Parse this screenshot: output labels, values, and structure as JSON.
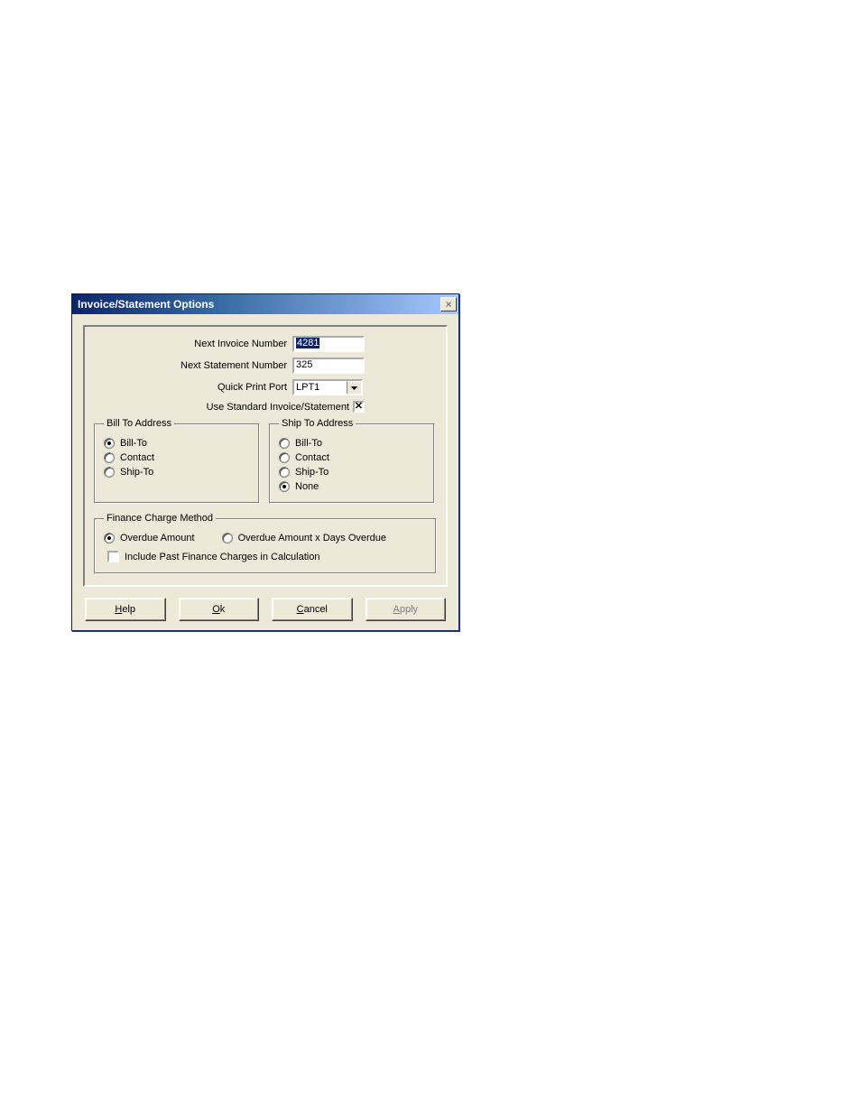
{
  "dialog": {
    "title": "Invoice/Statement Options",
    "close_glyph": "×",
    "fields": {
      "next_invoice_label": "Next Invoice Number",
      "next_invoice_value": "4281",
      "next_statement_label": "Next Statement Number",
      "next_statement_value": "325",
      "quick_print_label": "Quick Print Port",
      "quick_print_value": "LPT1",
      "use_standard_label": "Use Standard Invoice/Statement",
      "use_standard_checked_glyph": "✕"
    },
    "bill_to": {
      "legend": "Bill To Address",
      "options": [
        {
          "label": "Bill-To",
          "selected": true
        },
        {
          "label": "Contact",
          "selected": false
        },
        {
          "label": "Ship-To",
          "selected": false
        }
      ]
    },
    "ship_to": {
      "legend": "Ship To Address",
      "options": [
        {
          "label": "Bill-To",
          "selected": false
        },
        {
          "label": "Contact",
          "selected": false
        },
        {
          "label": "Ship-To",
          "selected": false
        },
        {
          "label": "None",
          "selected": true
        }
      ]
    },
    "fcm": {
      "legend": "Finance Charge Method",
      "overdue_amount_label": "Overdue Amount",
      "overdue_amount_selected": true,
      "overdue_days_label": "Overdue Amount x Days Overdue",
      "overdue_days_selected": false,
      "include_past_label": "Include Past Finance Charges in Calculation",
      "include_past_checked": false
    },
    "buttons": {
      "help_pre": "",
      "help_mn": "H",
      "help_post": "elp",
      "ok_pre": "",
      "ok_mn": "O",
      "ok_post": "k",
      "cancel_pre": "",
      "cancel_mn": "C",
      "cancel_post": "ancel",
      "apply_pre": "",
      "apply_mn": "A",
      "apply_post": "pply"
    }
  }
}
